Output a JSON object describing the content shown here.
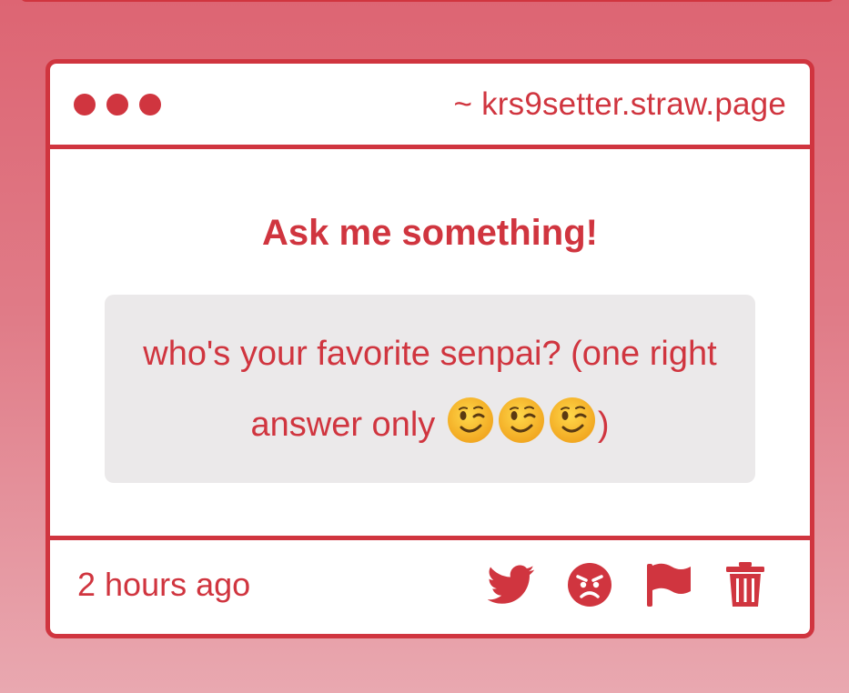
{
  "colors": {
    "accent": "#d0353f",
    "background_top": "#dd6573",
    "background_bottom": "#e9a8b0",
    "question_bg": "#ebe9ea",
    "card_bg": "#ffffff"
  },
  "card": {
    "header": {
      "url": "~ krs9setter.straw.page",
      "dots": [
        "dot",
        "dot",
        "dot"
      ]
    },
    "body": {
      "heading": "Ask me something!",
      "question_text": "who's your favorite senpai? (one right answer only ",
      "question_emojis": [
        "winking-face",
        "winking-face",
        "winking-face"
      ],
      "question_close": ")"
    },
    "footer": {
      "time": "2 hours ago",
      "actions": [
        "twitter-icon",
        "angry-face-icon",
        "flag-icon",
        "trash-icon"
      ]
    }
  }
}
